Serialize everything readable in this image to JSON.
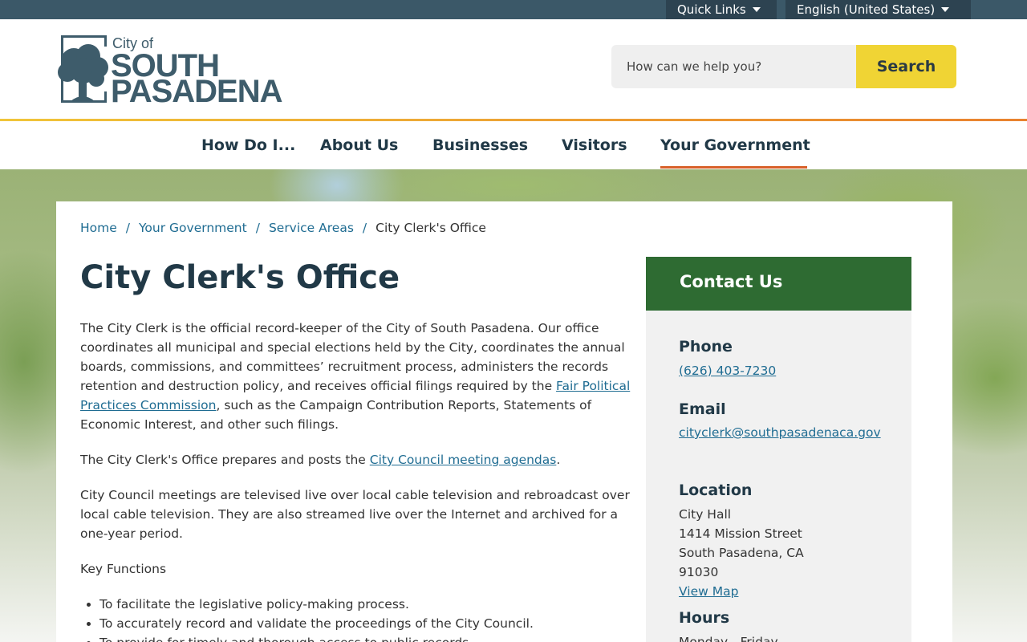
{
  "utility": {
    "quick_links": "Quick Links",
    "language": "English (United States)"
  },
  "logo": {
    "city_of": "City of",
    "line1": "SOUTH",
    "line2": "PASADENA"
  },
  "search": {
    "placeholder": "How can we help you?",
    "button": "Search"
  },
  "nav": {
    "items": [
      {
        "label": "How Do I..."
      },
      {
        "label": "About Us"
      },
      {
        "label": "Businesses"
      },
      {
        "label": "Visitors"
      },
      {
        "label": "Your Government",
        "active": true
      }
    ]
  },
  "breadcrumb": {
    "home": "Home",
    "your_government": "Your Government",
    "service_areas": "Service Areas",
    "current": "City Clerk's Office",
    "separator": "/"
  },
  "main": {
    "title": "City Clerk's Office",
    "p1_before": "The City Clerk is the official record-keeper of the City of South Pasadena. Our office coordinates all municipal and special elections held by the City, coordinates the annual boards, commissions, and committees’ recruitment process, administers the records retention and destruction policy, and receives official filings required by the ",
    "p1_link": "Fair Political Practices Commission",
    "p1_after": ", such as the Campaign Contribution Reports, Statements of Economic Interest, and other such filings.",
    "p2_before": "The City Clerk's Office prepares and posts the ",
    "p2_link": "City Council meeting agendas",
    "p2_after": ".",
    "p3": "City Council meetings are televised live over local cable television and rebroadcast over local cable television. They are also streamed live over the Internet and archived for a one-year period.",
    "p4": "Key Functions",
    "functions": [
      "To facilitate the legislative policy-making process.",
      "To accurately record and validate the proceedings of the City Council.",
      "To provide for timely and thorough access to public records."
    ]
  },
  "contact": {
    "heading": "Contact Us",
    "phone_label": "Phone",
    "phone": "(626) 403-7230",
    "email_label": "Email",
    "email": "cityclerk@southpasadenaca.gov",
    "location_label": "Location",
    "location_lines": [
      "City Hall",
      "1414 Mission Street",
      "South Pasadena, CA",
      "91030"
    ],
    "map_link": "View Map",
    "hours_label": "Hours",
    "hours": "Monday - Friday"
  },
  "colors": {
    "utility_bar": "#3b5868",
    "search_button": "#f0d434",
    "nav_active": "#d8612a",
    "contact_header": "#2e6b32",
    "link": "#1f6c92",
    "heading": "#213947"
  }
}
